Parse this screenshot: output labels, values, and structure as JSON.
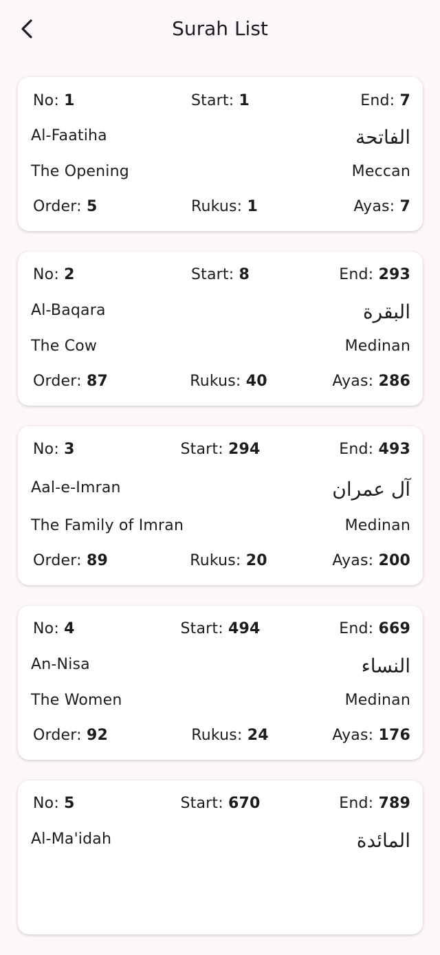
{
  "header": {
    "title": "Surah List"
  },
  "labels": {
    "no": "No:",
    "start": "Start:",
    "end": "End:",
    "order": "Order:",
    "rukus": "Rukus:",
    "ayas": "Ayas:"
  },
  "surahs": [
    {
      "no": "1",
      "start": "1",
      "end": "7",
      "name": "Al-Faatiha",
      "arabic": "الفاتحة",
      "english": "The Opening",
      "type": "Meccan",
      "order": "5",
      "rukus": "1",
      "ayas": "7"
    },
    {
      "no": "2",
      "start": "8",
      "end": "293",
      "name": "Al-Baqara",
      "arabic": "البقرة",
      "english": "The Cow",
      "type": "Medinan",
      "order": "87",
      "rukus": "40",
      "ayas": "286"
    },
    {
      "no": "3",
      "start": "294",
      "end": "493",
      "name": "Aal-e-Imran",
      "arabic": "آل عمران",
      "english": "The Family of Imran",
      "type": "Medinan",
      "order": "89",
      "rukus": "20",
      "ayas": "200"
    },
    {
      "no": "4",
      "start": "494",
      "end": "669",
      "name": "An-Nisa",
      "arabic": "النساء",
      "english": "The Women",
      "type": "Medinan",
      "order": "92",
      "rukus": "24",
      "ayas": "176"
    },
    {
      "no": "5",
      "start": "670",
      "end": "789",
      "name": "Al-Ma'idah",
      "arabic": "المائدة"
    }
  ]
}
